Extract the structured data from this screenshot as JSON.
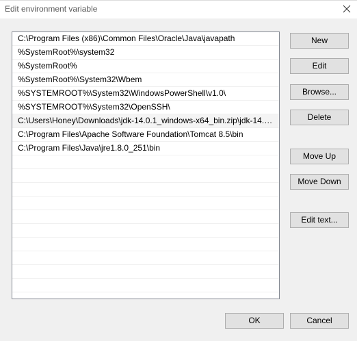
{
  "window": {
    "title": "Edit environment variable"
  },
  "list": {
    "items": [
      "C:\\Program Files (x86)\\Common Files\\Oracle\\Java\\javapath",
      "%SystemRoot%\\system32",
      "%SystemRoot%",
      "%SystemRoot%\\System32\\Wbem",
      "%SYSTEMROOT%\\System32\\WindowsPowerShell\\v1.0\\",
      "%SYSTEMROOT%\\System32\\OpenSSH\\",
      "C:\\Users\\Honey\\Downloads\\jdk-14.0.1_windows-x64_bin.zip\\jdk-14.0....",
      "C:\\Program Files\\Apache Software Foundation\\Tomcat 8.5\\bin",
      "C:\\Program Files\\Java\\jre1.8.0_251\\bin"
    ],
    "selected_index": 6
  },
  "buttons": {
    "new": "New",
    "edit": "Edit",
    "browse": "Browse...",
    "delete": "Delete",
    "move_up": "Move Up",
    "move_down": "Move Down",
    "edit_text": "Edit text...",
    "ok": "OK",
    "cancel": "Cancel"
  },
  "icons": {
    "close": "close-icon"
  },
  "colors": {
    "dialog_background": "#f0f0f0",
    "titlebar_background": "#ffffff",
    "button_face": "#e1e1e1",
    "button_border": "#adadad",
    "list_border": "#828790",
    "selected_row": "#f4f4f4"
  }
}
